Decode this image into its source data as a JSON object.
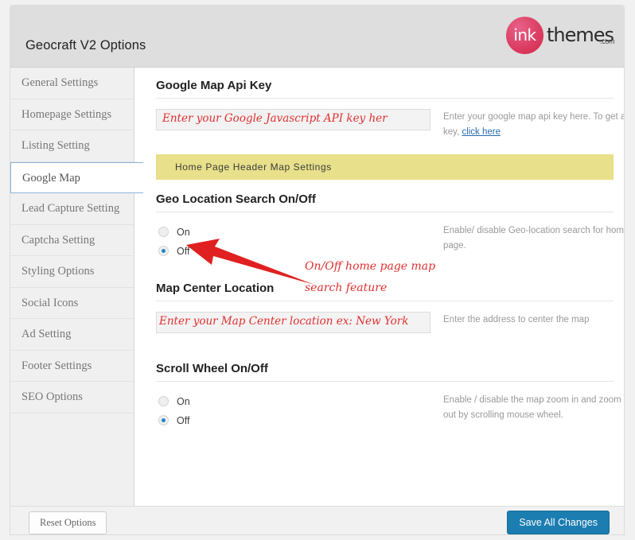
{
  "header": {
    "title": "Geocraft V2 Options",
    "logo": {
      "badge_text": "ink",
      "word": "themes",
      "tld": ".com"
    }
  },
  "sidebar": {
    "items": [
      {
        "label": "General Settings",
        "active": false
      },
      {
        "label": "Homepage Settings",
        "active": false
      },
      {
        "label": "Listing Setting",
        "active": false
      },
      {
        "label": "Google Map",
        "active": true
      },
      {
        "label": "Lead Capture Setting",
        "active": false
      },
      {
        "label": "Captcha Setting",
        "active": false
      },
      {
        "label": "Styling Options",
        "active": false
      },
      {
        "label": "Social Icons",
        "active": false
      },
      {
        "label": "Ad Setting",
        "active": false
      },
      {
        "label": "Footer Settings",
        "active": false
      },
      {
        "label": "SEO Options",
        "active": false
      }
    ]
  },
  "main": {
    "api_key": {
      "title": "Google Map Api Key",
      "value": "",
      "annotation": "Enter your Google Javascript API key her",
      "hint_text": "Enter your google map api key here. To get api key, ",
      "hint_link": "click here"
    },
    "banner": "Home Page Header Map Settings",
    "geo_search": {
      "title": "Geo Location Search On/Off",
      "option_on": "On",
      "option_off": "Off",
      "selected": "Off",
      "hint": "Enable/ disable Geo-location search for home page."
    },
    "map_center": {
      "title": "Map Center Location",
      "value": "",
      "annotation": "Enter your Map Center location ex: New York",
      "hint": "Enter the address to center the map"
    },
    "scroll_wheel": {
      "title": "Scroll Wheel On/Off",
      "option_on": "On",
      "option_off": "Off",
      "selected": "Off",
      "hint": "Enable / disable the map zoom in and zoom out by scrolling mouse wheel."
    }
  },
  "annotations": {
    "arrow_note_line1": "On/Off home page map",
    "arrow_note_line2": "search feature",
    "arrow_color": "#e02020"
  },
  "footer": {
    "reset_label": "Reset Options",
    "save_label": "Save All Changes"
  },
  "colors": {
    "accent_blue": "#1b7db0",
    "banner_yellow": "#e8e08a",
    "annotation_red": "#e03030",
    "brand_pink": "#dc3f63"
  }
}
